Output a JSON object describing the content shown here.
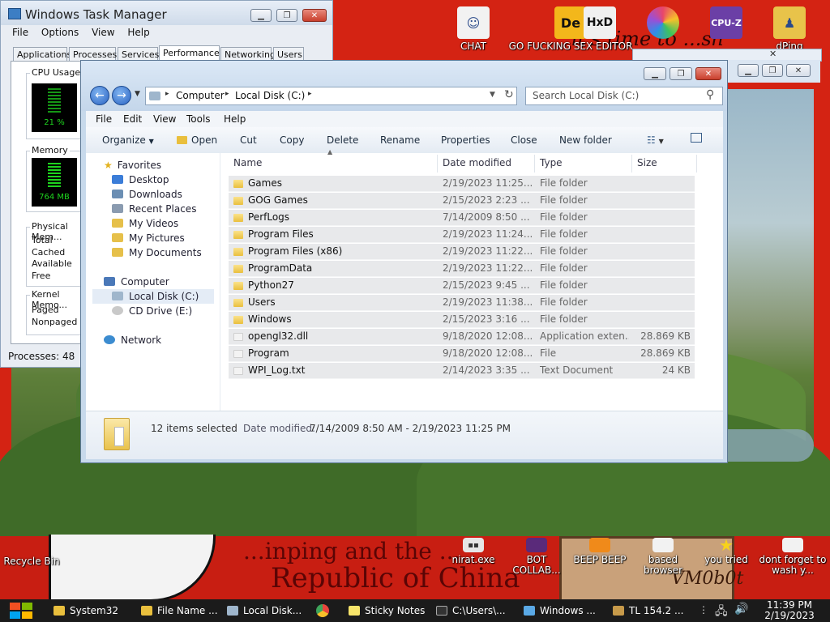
{
  "desktop": {
    "icons_top": [
      {
        "label": "CHAT",
        "icon": "doctor-avatar-icon",
        "color": "#f2f2f2"
      },
      {
        "label": "GO FUCKING SEX EDITOR",
        "icon": "de-editor-icon",
        "color": "#f3b71b"
      },
      {
        "label": "",
        "icon": "hxd-hex-editor-icon",
        "color": "#f0f0f0"
      },
      {
        "label": "",
        "icon": "colorful-ring-icon",
        "color": "#e9466a"
      },
      {
        "label": "",
        "icon": "cpuz-icon",
        "color": "#6b3fa6"
      },
      {
        "label": "dPing",
        "icon": "user-folder-icon",
        "color": "#e8c34a"
      }
    ],
    "icons_bottom": [
      {
        "label": "Recycle Bin",
        "icon": "recycle-bin-icon"
      },
      {
        "label": "nirat.exe",
        "icon": "terminal-icon"
      },
      {
        "label": "BOT COLLAB...",
        "icon": "collab-icon"
      },
      {
        "label": "BEEP BEEP",
        "icon": "beep-icon"
      },
      {
        "label": "based browser",
        "icon": "browser-icon"
      },
      {
        "label": "you tried",
        "icon": "star-icon"
      },
      {
        "label": "dont forget to wash y...",
        "icon": "note-icon"
      }
    ],
    "wallpaper_text": {
      "banner": "it's time to ...sh",
      "republic": "Republic of China",
      "jinping": "...inping and the ...",
      "tag": "VM0b0t"
    }
  },
  "taskmgr": {
    "title": "Windows Task Manager",
    "menu": [
      "File",
      "Options",
      "View",
      "Help"
    ],
    "tabs": [
      "Applications",
      "Processes",
      "Services",
      "Performance",
      "Networking",
      "Users"
    ],
    "active_tab": "Performance",
    "cpu": {
      "label": "CPU Usage",
      "value": "21 %",
      "level": 0.21
    },
    "memory": {
      "label": "Memory",
      "value": "764 MB"
    },
    "physical": {
      "label": "Physical Mem...",
      "rows": [
        "Total",
        "Cached",
        "Available",
        "Free"
      ]
    },
    "kernel": {
      "label": "Kernel Memo...",
      "rows": [
        "Paged",
        "Nonpaged"
      ]
    },
    "status": "Processes: 48"
  },
  "explorer": {
    "breadcrumb": [
      "Computer",
      "Local Disk (C:)"
    ],
    "search_placeholder": "Search Local Disk (C:)",
    "menu": [
      "File",
      "Edit",
      "View",
      "Tools",
      "Help"
    ],
    "toolbar": {
      "organize": "Organize",
      "open": "Open",
      "cut": "Cut",
      "copy": "Copy",
      "delete": "Delete",
      "rename": "Rename",
      "properties": "Properties",
      "close": "Close",
      "new_folder": "New folder"
    },
    "nav": {
      "favorites": "Favorites",
      "favorites_items": [
        "Desktop",
        "Downloads",
        "Recent Places",
        "My Videos",
        "My Pictures",
        "My Documents"
      ],
      "computer": "Computer",
      "computer_items": [
        "Local Disk (C:)",
        "CD Drive (E:)"
      ],
      "network": "Network"
    },
    "columns": [
      "Name",
      "Date modified",
      "Type",
      "Size"
    ],
    "files": [
      {
        "name": "Games",
        "date": "2/19/2023 11:25...",
        "type": "File folder",
        "size": "",
        "kind": "folder"
      },
      {
        "name": "GOG Games",
        "date": "2/15/2023 2:23 ...",
        "type": "File folder",
        "size": "",
        "kind": "folder"
      },
      {
        "name": "PerfLogs",
        "date": "7/14/2009 8:50 ...",
        "type": "File folder",
        "size": "",
        "kind": "folder"
      },
      {
        "name": "Program Files",
        "date": "2/19/2023 11:24...",
        "type": "File folder",
        "size": "",
        "kind": "folder"
      },
      {
        "name": "Program Files (x86)",
        "date": "2/19/2023 11:22...",
        "type": "File folder",
        "size": "",
        "kind": "folder"
      },
      {
        "name": "ProgramData",
        "date": "2/19/2023 11:22...",
        "type": "File folder",
        "size": "",
        "kind": "folder"
      },
      {
        "name": "Python27",
        "date": "2/15/2023 9:45 ...",
        "type": "File folder",
        "size": "",
        "kind": "folder"
      },
      {
        "name": "Users",
        "date": "2/19/2023 11:38...",
        "type": "File folder",
        "size": "",
        "kind": "folder"
      },
      {
        "name": "Windows",
        "date": "2/15/2023 3:16 ...",
        "type": "File folder",
        "size": "",
        "kind": "folder"
      },
      {
        "name": "opengl32.dll",
        "date": "9/18/2020 12:08...",
        "type": "Application exten...",
        "size": "28.869 KB",
        "kind": "file"
      },
      {
        "name": "Program",
        "date": "9/18/2020 12:08...",
        "type": "File",
        "size": "28.869 KB",
        "kind": "file"
      },
      {
        "name": "WPI_Log.txt",
        "date": "2/14/2023 3:35 ...",
        "type": "Text Document",
        "size": "24 KB",
        "kind": "file"
      }
    ],
    "details": {
      "selected": "12 items selected",
      "date_label": "Date modified:",
      "date_range": "7/14/2009 8:50 AM - 2/19/2023 11:25 PM"
    }
  },
  "taskbar": {
    "items": [
      {
        "label": "System32",
        "icon": "folder-icon",
        "color": "#e9bf3d"
      },
      {
        "label": "File Name ...",
        "icon": "folder-icon",
        "color": "#e9bf3d"
      },
      {
        "label": "Local Disk...",
        "icon": "drive-icon",
        "color": "#9fb6cc"
      },
      {
        "label": "",
        "icon": "chrome-icon",
        "color": "#e8453c"
      },
      {
        "label": "Sticky Notes",
        "icon": "sticky-notes-icon",
        "color": "#f7e46a"
      },
      {
        "label": "C:\\Users\\...",
        "icon": "cmd-icon",
        "color": "#333333"
      },
      {
        "label": "Windows ...",
        "icon": "taskmgr-icon",
        "color": "#5aa9e6"
      },
      {
        "label": "TL 154.2 ...",
        "icon": "box-icon",
        "color": "#c79a4a"
      }
    ],
    "clock": {
      "time": "11:39 PM",
      "date": "2/19/2023"
    }
  }
}
